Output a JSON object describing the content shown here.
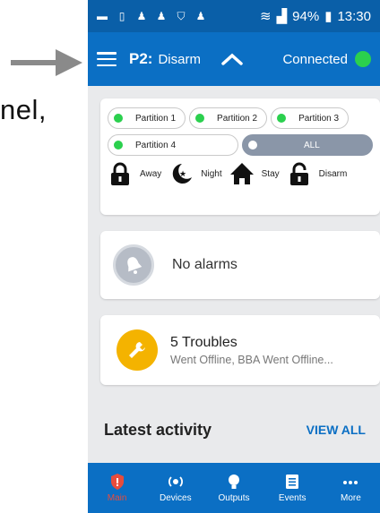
{
  "doc": {
    "overlay_text": "nel,"
  },
  "status_bar": {
    "battery": "94%",
    "time": "13:30"
  },
  "appbar": {
    "partition": "P2:",
    "arm_state": "Disarm",
    "connection": "Connected",
    "connection_color": "#2bd04e"
  },
  "partitions": [
    {
      "label": "Partition 1"
    },
    {
      "label": "Partition 2"
    },
    {
      "label": "Partition 3"
    },
    {
      "label": "Partition 4"
    },
    {
      "label": "ALL"
    }
  ],
  "arm_buttons": [
    {
      "label": "Away",
      "icon": "lock-icon"
    },
    {
      "label": "Night",
      "icon": "moon-stars-icon"
    },
    {
      "label": "Stay",
      "icon": "home-icon"
    },
    {
      "label": "Disarm",
      "icon": "unlock-icon"
    }
  ],
  "alarm_card": {
    "text": "No alarms",
    "icon": "bell-icon"
  },
  "trouble_card": {
    "title": "5 Troubles",
    "subtitle": "Went Offline, BBA Went Offline...",
    "icon": "wrench-icon",
    "color": "#f4b300"
  },
  "latest_activity": {
    "title": "Latest activity",
    "view_all": "VIEW ALL"
  },
  "bottom_nav": [
    {
      "label": "Main",
      "icon": "shield-icon",
      "active": true
    },
    {
      "label": "Devices",
      "icon": "sensor-icon"
    },
    {
      "label": "Outputs",
      "icon": "bulb-icon"
    },
    {
      "label": "Events",
      "icon": "list-icon"
    },
    {
      "label": "More",
      "icon": "more-icon"
    }
  ],
  "colors": {
    "primary": "#0b6fc4",
    "status_bar": "#0a5fa8",
    "active_nav": "#e74c3c"
  }
}
